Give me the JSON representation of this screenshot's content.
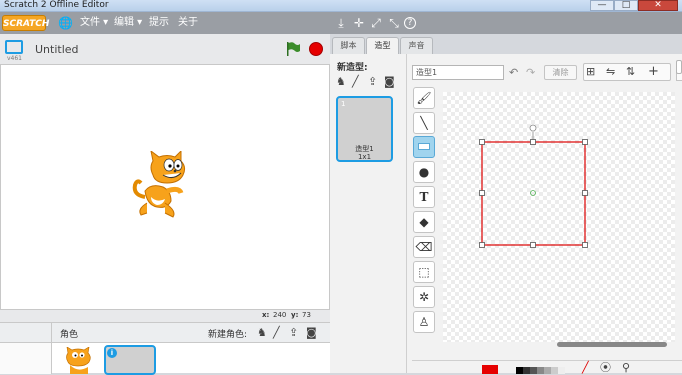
{
  "window": {
    "title": "Scratch 2 Offline Editor",
    "minimize": "—",
    "maximize": "□",
    "close": "✕"
  },
  "menubar": {
    "logo": "SCRATCH",
    "items": [
      "文件 ▾",
      "编辑 ▾",
      "提示",
      "关于"
    ],
    "tools": [
      "⤓",
      "✛",
      "⤢",
      "⤡",
      "?"
    ]
  },
  "stage": {
    "project_title": "Untitled",
    "version": "v461",
    "x_label": "x:",
    "x_value": "240",
    "y_label": "y:",
    "y_value": "73"
  },
  "sprites": {
    "header_label": "角色",
    "new_sprite_label": "新建角色:",
    "selected_badge": "i"
  },
  "tabs": [
    "脚本",
    "造型",
    "声音"
  ],
  "costumes": {
    "new_label": "新造型:",
    "items": [
      {
        "index": "1",
        "name": "造型1",
        "size": "1x1"
      }
    ]
  },
  "editor": {
    "costume_name": "造型1",
    "clear_label": "清除",
    "tools": [
      "brush",
      "line",
      "rectangle",
      "ellipse",
      "text",
      "fill",
      "eraser",
      "select",
      "duplicate",
      "stamp"
    ],
    "selected_tool": "rectangle",
    "primary_color": "#e60000"
  },
  "colors": {
    "accent": "#1d9ce3",
    "menubar": "#9a9ea4",
    "stop": "#e60000",
    "go": "#3b8c2a"
  }
}
